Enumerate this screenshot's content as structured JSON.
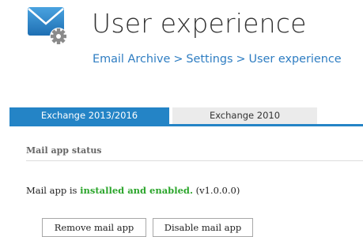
{
  "header": {
    "icon": "email-settings-icon",
    "title": "User experience",
    "breadcrumb": {
      "items": [
        "Email Archive",
        "Settings",
        "User experience"
      ],
      "separator": ">"
    }
  },
  "tabs": [
    {
      "label": "Exchange 2013/2016",
      "active": true
    },
    {
      "label": "Exchange 2010",
      "active": false
    }
  ],
  "section": {
    "title": "Mail app status",
    "status": {
      "prefix": "Mail app is ",
      "state": "installed and enabled.",
      "version": "(v1.0.0.0)"
    }
  },
  "actions": {
    "remove_label": "Remove mail app",
    "disable_label": "Disable mail app"
  },
  "colors": {
    "accent": "#2484c6",
    "link": "#2e7dc2",
    "success": "#2ba52b"
  }
}
